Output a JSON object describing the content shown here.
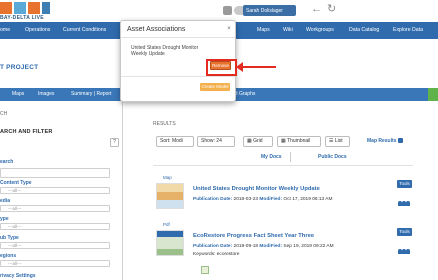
{
  "brand": {
    "tagline": "BAY-DELTA LIVE",
    "colors": {
      "orange": "#e8732f",
      "light_blue": "#5aa9d6",
      "blue": "#2f6bad"
    }
  },
  "header": {
    "user_label": "Sarah Dolislager",
    "icons": [
      "print-icon",
      "toggle-icon",
      "back-arrow-icon",
      "forward-arrow-icon"
    ]
  },
  "mainnav": {
    "items": [
      "ome",
      "Operations",
      "Current Conditions",
      "Maps",
      "Wiki",
      "Workgroups",
      "Data Catalog",
      "Explore Data"
    ]
  },
  "project": {
    "title": "T PROJECT"
  },
  "subnav": {
    "items": [
      "Maps",
      "Images",
      "Summary | Report"
    ],
    "graphs_label": "nd Graphs"
  },
  "sidebar": {
    "heading": "CH",
    "title": "ARCH AND FILTER",
    "help_label": "?",
    "search_label": "earch",
    "content_type_label": "Content Type",
    "content_type_value": "---all---",
    "media_label": "edia",
    "media_value": "---all---",
    "type_label": "ype",
    "type_value": "---all---",
    "sub_type_label": "ub Type",
    "sub_type_value": "---all---",
    "regions_label": "egions",
    "regions_value": "---all---",
    "privacy_label": "rivacy Settings"
  },
  "results": {
    "label": "RESULTS",
    "sort_label": "Sort: Modi",
    "show_label": "Show: 24",
    "grid_label": "Grid",
    "thumbnail_label": "Thumbnail",
    "list_label": "List",
    "map_results_label": "Map Results",
    "my_docs_label": "My Docs",
    "public_docs_label": "Public Docs",
    "items": [
      {
        "type": "Map",
        "title": "United States Drought Monitor Weekly Update",
        "publication_label": "Publication Date:",
        "publication_date": "2018-03-23",
        "modified_label": "ModiFied:",
        "modified_date": "Oct 17, 2019 06:13 AM",
        "tools_label": "Tools"
      },
      {
        "type": "Pdf",
        "title": "EcoRestore Progress Fact Sheet Year Three",
        "publication_label": "Publication Date:",
        "publication_date": "2019-09-18",
        "modified_label": "ModiFied:",
        "modified_date": "Sep 19, 2019 09:22 AM",
        "keywords_label": "Keywords:",
        "keywords": "ecorestore",
        "tools_label": "Tools"
      }
    ]
  },
  "modal": {
    "title": "Asset Associations",
    "close_label": "×",
    "item_label": "United States Drought Monitor Weekly Update",
    "remove_label": "Remove",
    "create_label": "Create Model"
  }
}
